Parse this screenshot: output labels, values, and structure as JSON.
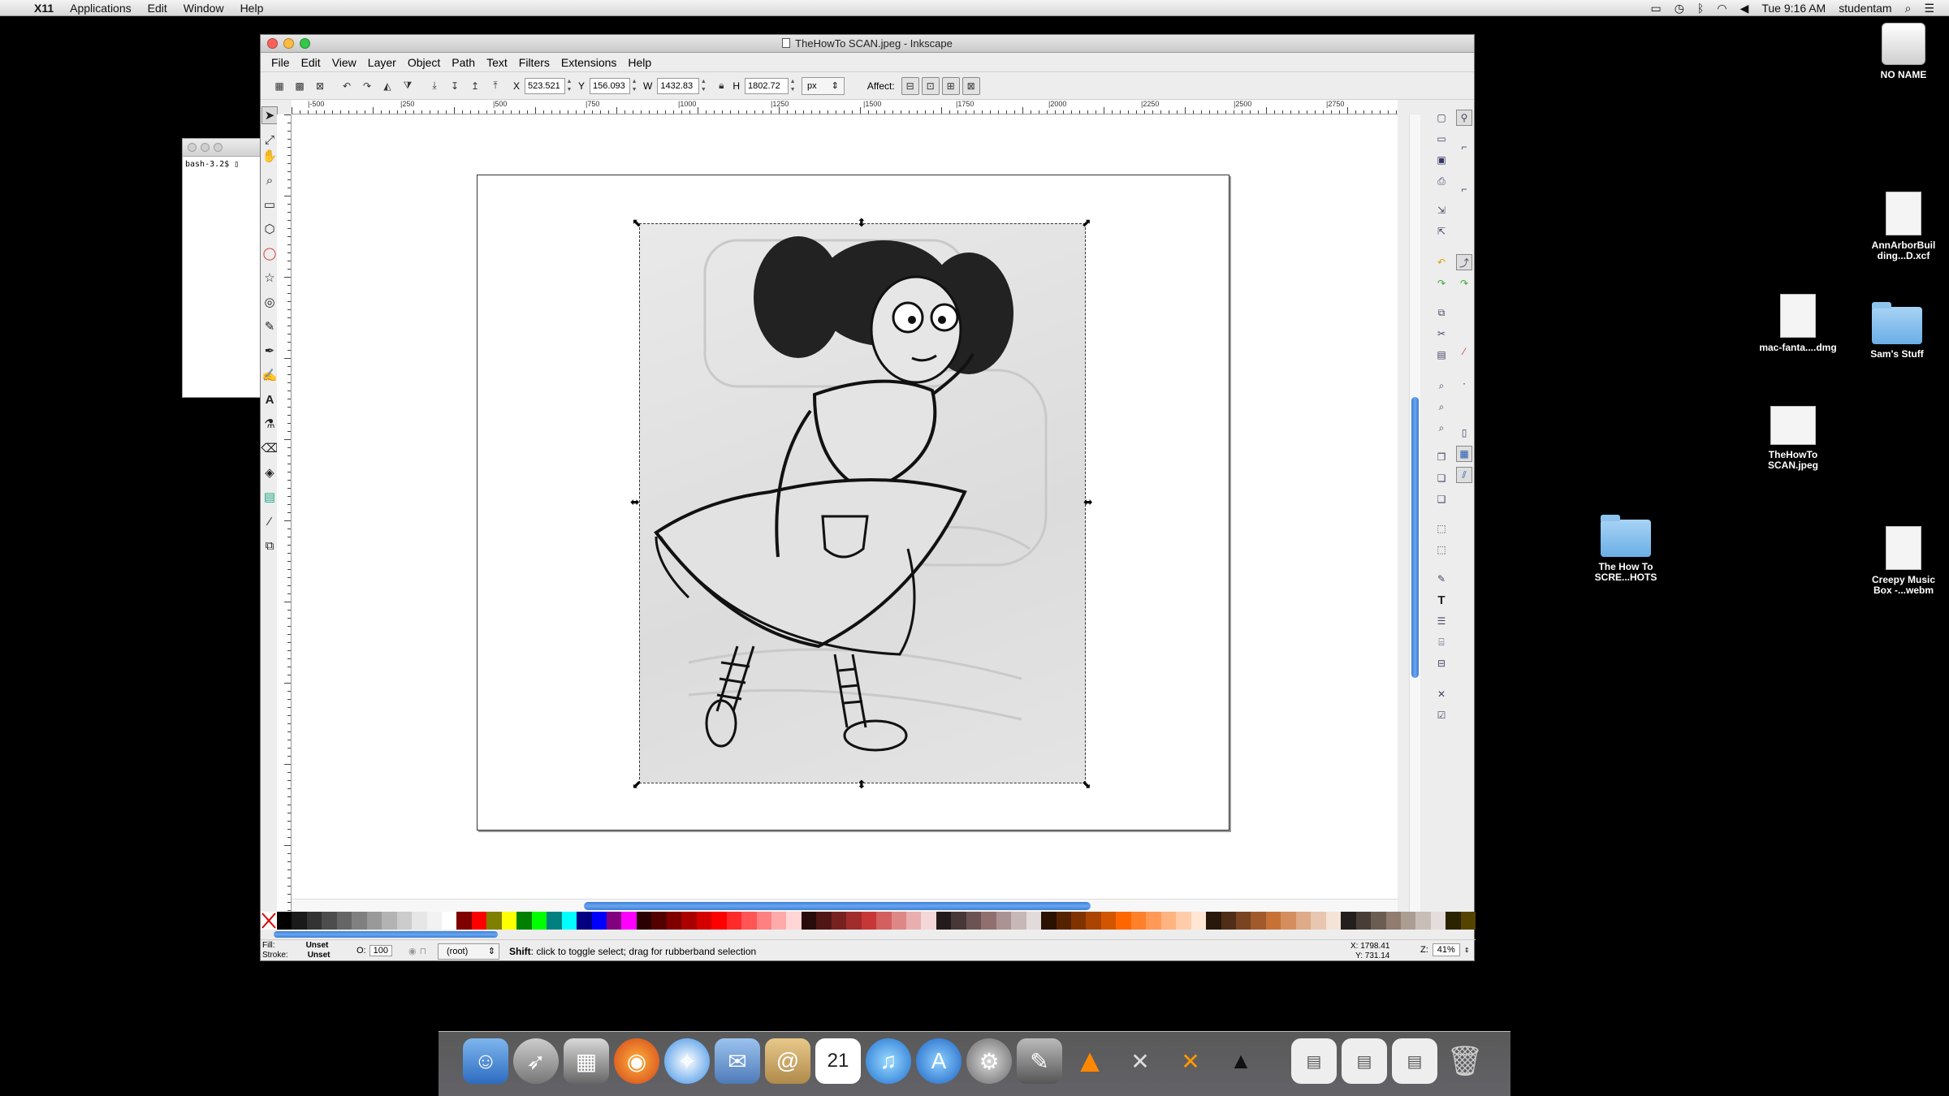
{
  "menubar": {
    "app": "X11",
    "items": [
      "Applications",
      "Edit",
      "Window",
      "Help"
    ],
    "clock": "Tue 9:16 AM",
    "user": "studentam"
  },
  "terminal": {
    "prompt": "bash-3.2$ ▯"
  },
  "window": {
    "title": "TheHowTo SCAN.jpeg - Inkscape",
    "menu": [
      "File",
      "Edit",
      "View",
      "Layer",
      "Object",
      "Path",
      "Text",
      "Filters",
      "Extensions",
      "Help"
    ]
  },
  "toolcontrols": {
    "x_label": "X",
    "x_value": "523.521",
    "y_label": "Y",
    "y_value": "156.093",
    "w_label": "W",
    "w_value": "1432.83",
    "h_label": "H",
    "h_value": "1802.72",
    "unit": "px",
    "affect_label": "Affect:"
  },
  "ruler": {
    "labels": [
      "|-500",
      "|250",
      "|500",
      "|750",
      "|1000",
      "|1250",
      "|1500",
      "|1750",
      "|2000",
      "|2250",
      "|2500",
      "|2750"
    ]
  },
  "statusbar": {
    "fill_label": "Fill:",
    "fill_value": "Unset",
    "stroke_label": "Stroke:",
    "stroke_value": "Unset",
    "opacity_label": "O:",
    "opacity_value": "100",
    "layer": "(root)",
    "message_bold": "Shift",
    "message": ": click to toggle select; drag for rubberband selection",
    "x_coord": "X: 1798.41",
    "y_coord": "Y:   731.14",
    "zoom_label": "Z:",
    "zoom_value": "41%"
  },
  "palette": [
    "#000000",
    "#1a1a1a",
    "#333333",
    "#4d4d4d",
    "#666666",
    "#808080",
    "#999999",
    "#b3b3b3",
    "#cccccc",
    "#e6e6e6",
    "#f2f2f2",
    "#ffffff",
    "#800000",
    "#ff0000",
    "#808000",
    "#ffff00",
    "#008000",
    "#00ff00",
    "#008080",
    "#00ffff",
    "#000080",
    "#0000ff",
    "#800080",
    "#ff00ff",
    "#2b0000",
    "#550000",
    "#800000",
    "#aa0000",
    "#d40000",
    "#ff0000",
    "#ff2a2a",
    "#ff5555",
    "#ff8080",
    "#ffaaaa",
    "#ffd5d5",
    "#280b0b",
    "#501616",
    "#782121",
    "#a02c2c",
    "#c83737",
    "#d35f5f",
    "#de8787",
    "#e9afaf",
    "#f4d7d7",
    "#241c1c",
    "#483737",
    "#6c5353",
    "#916f6f",
    "#ac9393",
    "#c8b7b7",
    "#e3dbdb",
    "#2b1100",
    "#552200",
    "#803300",
    "#aa4400",
    "#d45500",
    "#ff6600",
    "#ff7f2a",
    "#ff9955",
    "#ffb380",
    "#ffccaa",
    "#ffe6d5",
    "#28170b",
    "#502d16",
    "#784421",
    "#a05a2c",
    "#c87137",
    "#d38d5f",
    "#deaa87",
    "#e9c6af",
    "#f4e3d7",
    "#241f1c",
    "#483e37",
    "#6c5d53",
    "#917c6f",
    "#ac9d93",
    "#c8beb7",
    "#e3dedb",
    "#2b2200",
    "#554400"
  ],
  "desktop": [
    {
      "name": "NO NAME"
    },
    {
      "name": "AnnArborBuil ding...D.xcf"
    },
    {
      "name": "mac-fanta....dmg"
    },
    {
      "name": "Sam's Stuff"
    },
    {
      "name": "TheHowTo SCAN.jpeg"
    },
    {
      "name": "The How To SCRE...HOTS"
    },
    {
      "name": "Creepy Music Box -...webm"
    }
  ],
  "colors": {
    "accent": "#4a8fe2",
    "desktop": "#000000"
  }
}
